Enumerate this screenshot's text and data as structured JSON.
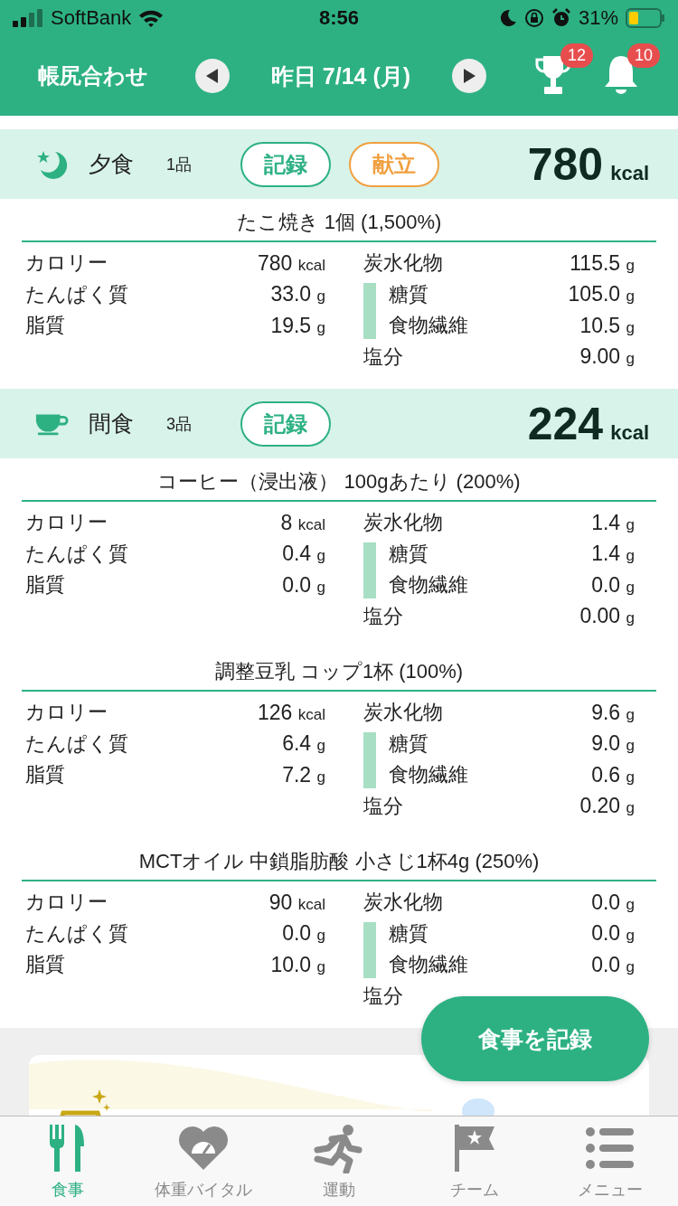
{
  "status_bar": {
    "carrier": "SoftBank",
    "time": "8:56",
    "battery": "31%"
  },
  "header": {
    "title": "帳尻合わせ",
    "date": "昨日 7/14 (月)",
    "trophy_badge": "12",
    "bell_badge": "10"
  },
  "meals": [
    {
      "kind": "dinner",
      "name": "夕食",
      "count": "1品",
      "kcal": "780",
      "unit": "kcal",
      "buttons": [
        {
          "label": "記録",
          "kind": "record"
        },
        {
          "label": "献立",
          "kind": "menu"
        }
      ],
      "foods": [
        {
          "title": "たこ焼き 1個  (1,500%)",
          "left": [
            {
              "label": "カロリー",
              "value": "780",
              "unit": "kcal"
            },
            {
              "label": "たんぱく質",
              "value": "33.0",
              "unit": "g"
            },
            {
              "label": "脂質",
              "value": "19.5",
              "unit": "g"
            }
          ],
          "right": [
            {
              "kind": "main",
              "label": "炭水化物",
              "value": "115.5",
              "unit": "g"
            },
            {
              "kind": "sub",
              "label": "糖質",
              "value": "105.0",
              "unit": "g"
            },
            {
              "kind": "sub",
              "label": "食物繊維",
              "value": "10.5",
              "unit": "g"
            },
            {
              "kind": "main",
              "label": "塩分",
              "value": "9.00",
              "unit": "g"
            }
          ]
        }
      ]
    },
    {
      "kind": "snack",
      "name": "間食",
      "count": "3品",
      "kcal": "224",
      "unit": "kcal",
      "buttons": [
        {
          "label": "記録",
          "kind": "record"
        }
      ],
      "foods": [
        {
          "title": "コーヒー（浸出液） 100gあたり  (200%)",
          "left": [
            {
              "label": "カロリー",
              "value": "8",
              "unit": "kcal"
            },
            {
              "label": "たんぱく質",
              "value": "0.4",
              "unit": "g"
            },
            {
              "label": "脂質",
              "value": "0.0",
              "unit": "g"
            }
          ],
          "right": [
            {
              "kind": "main",
              "label": "炭水化物",
              "value": "1.4",
              "unit": "g"
            },
            {
              "kind": "sub",
              "label": "糖質",
              "value": "1.4",
              "unit": "g"
            },
            {
              "kind": "sub",
              "label": "食物繊維",
              "value": "0.0",
              "unit": "g"
            },
            {
              "kind": "main",
              "label": "塩分",
              "value": "0.00",
              "unit": "g"
            }
          ]
        },
        {
          "title": "調整豆乳 コップ1杯  (100%)",
          "left": [
            {
              "label": "カロリー",
              "value": "126",
              "unit": "kcal"
            },
            {
              "label": "たんぱく質",
              "value": "6.4",
              "unit": "g"
            },
            {
              "label": "脂質",
              "value": "7.2",
              "unit": "g"
            }
          ],
          "right": [
            {
              "kind": "main",
              "label": "炭水化物",
              "value": "9.6",
              "unit": "g"
            },
            {
              "kind": "sub",
              "label": "糖質",
              "value": "9.0",
              "unit": "g"
            },
            {
              "kind": "sub",
              "label": "食物繊維",
              "value": "0.6",
              "unit": "g"
            },
            {
              "kind": "main",
              "label": "塩分",
              "value": "0.20",
              "unit": "g"
            }
          ]
        },
        {
          "title": "MCTオイル 中鎖脂肪酸 小さじ1杯4g  (250%)",
          "left": [
            {
              "label": "カロリー",
              "value": "90",
              "unit": "kcal"
            },
            {
              "label": "たんぱく質",
              "value": "0.0",
              "unit": "g"
            },
            {
              "label": "脂質",
              "value": "10.0",
              "unit": "g"
            }
          ],
          "right": [
            {
              "kind": "main",
              "label": "炭水化物",
              "value": "0.0",
              "unit": "g"
            },
            {
              "kind": "sub",
              "label": "糖質",
              "value": "0.0",
              "unit": "g"
            },
            {
              "kind": "sub",
              "label": "食物繊維",
              "value": "0.0",
              "unit": "g"
            },
            {
              "kind": "main",
              "label": "塩分"
            }
          ]
        }
      ]
    }
  ],
  "fab": {
    "label": "食事を記録"
  },
  "tabs": [
    {
      "label": "食事",
      "kind": "meal",
      "selected": true
    },
    {
      "label": "体重バイタル",
      "kind": "weight",
      "selected": false
    },
    {
      "label": "運動",
      "kind": "exercise",
      "selected": false
    },
    {
      "label": "チーム",
      "kind": "team",
      "selected": false
    },
    {
      "label": "メニュー",
      "kind": "menu",
      "selected": false
    }
  ]
}
